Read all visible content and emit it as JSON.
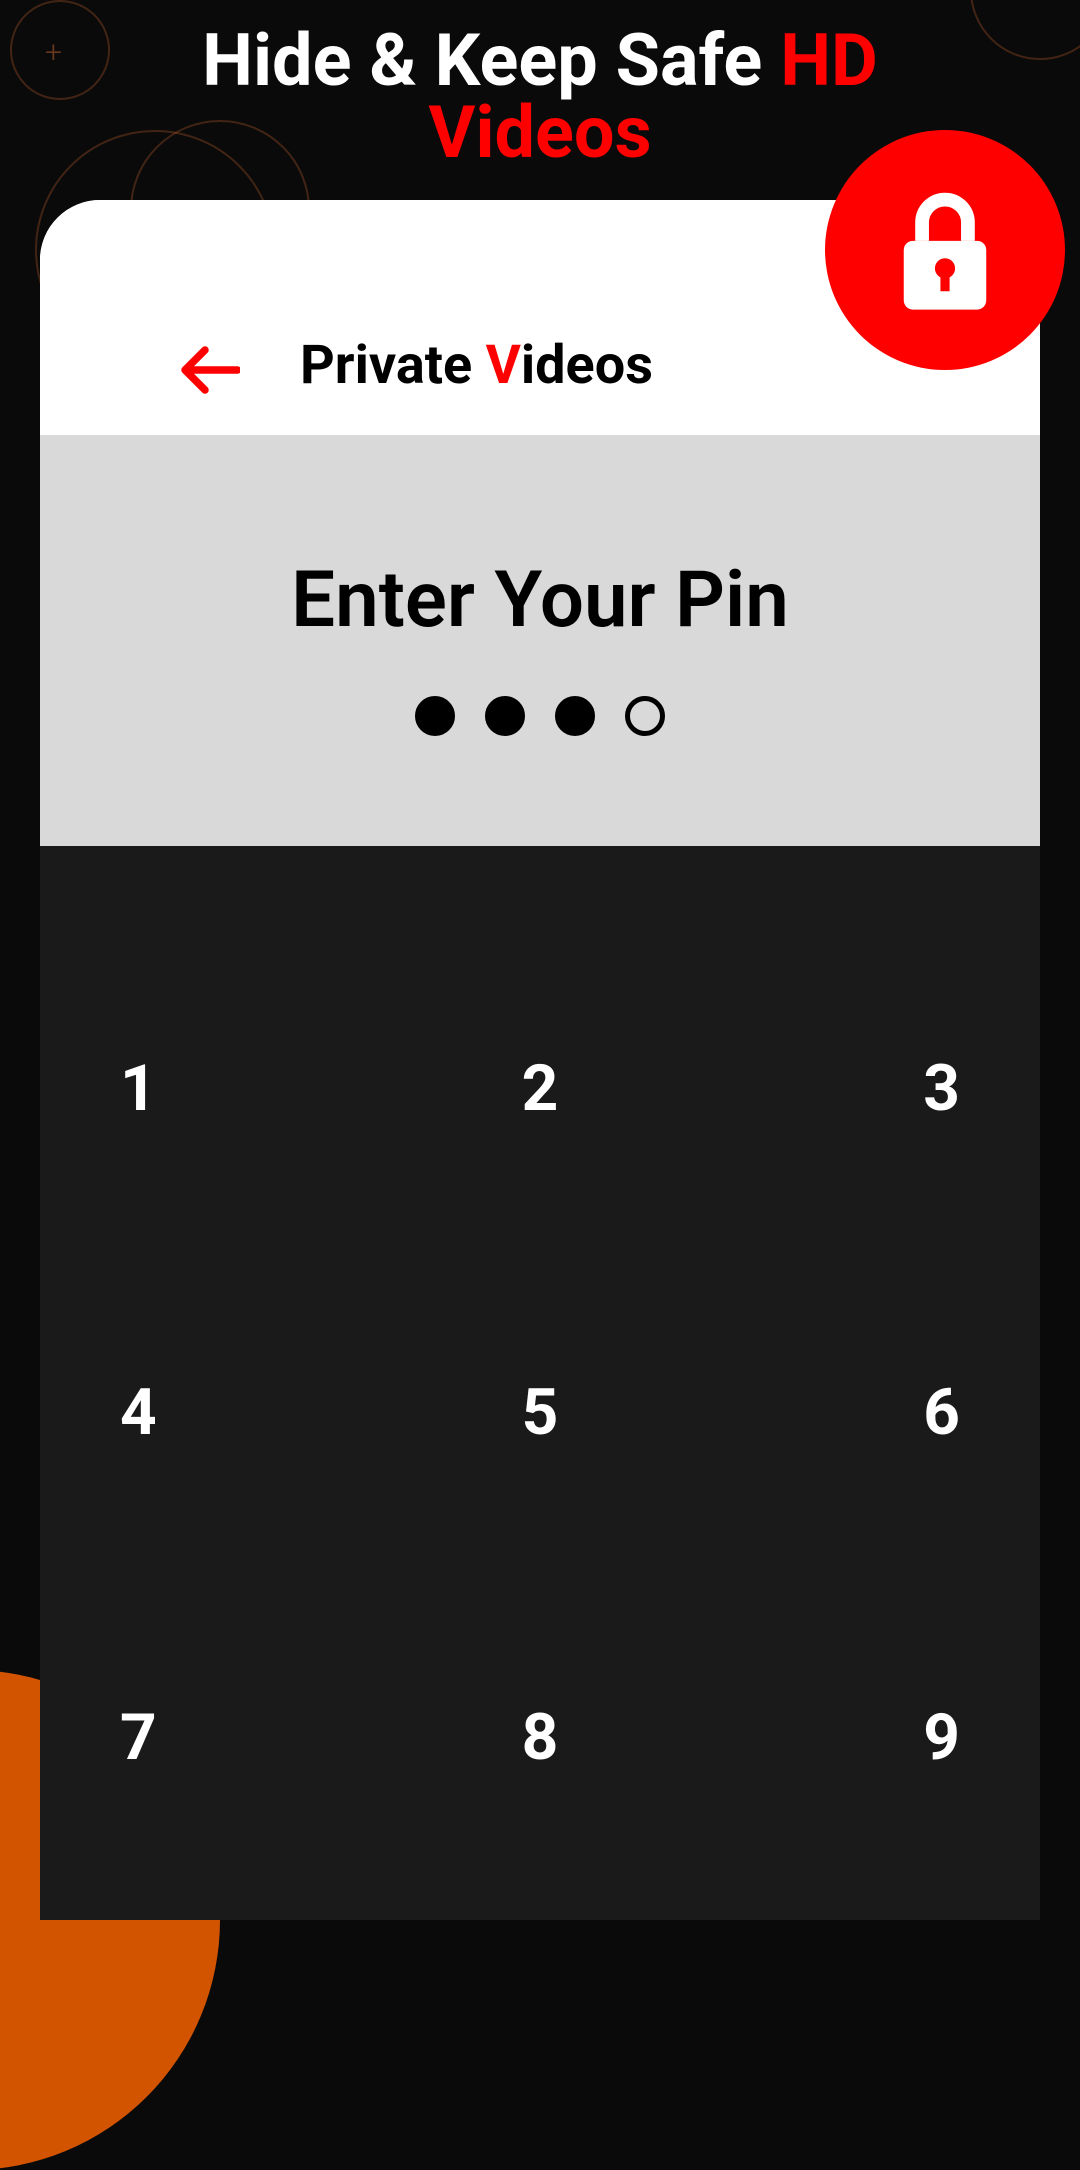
{
  "header": {
    "title_part1": "Hide & Keep Safe ",
    "title_part2": "HD",
    "title_part3": "Videos"
  },
  "card": {
    "title_part1": "Private ",
    "title_part2": "V",
    "title_part3": "ideos"
  },
  "pin": {
    "prompt": "Enter Your Pin",
    "entered_count": 3,
    "total_count": 4
  },
  "keypad": {
    "keys": [
      "1",
      "2",
      "3",
      "4",
      "5",
      "6",
      "7",
      "8",
      "9"
    ]
  },
  "colors": {
    "accent": "#ff0000",
    "keypad_bg": "#1a1a1a",
    "pin_bg": "#d9d9d9"
  }
}
